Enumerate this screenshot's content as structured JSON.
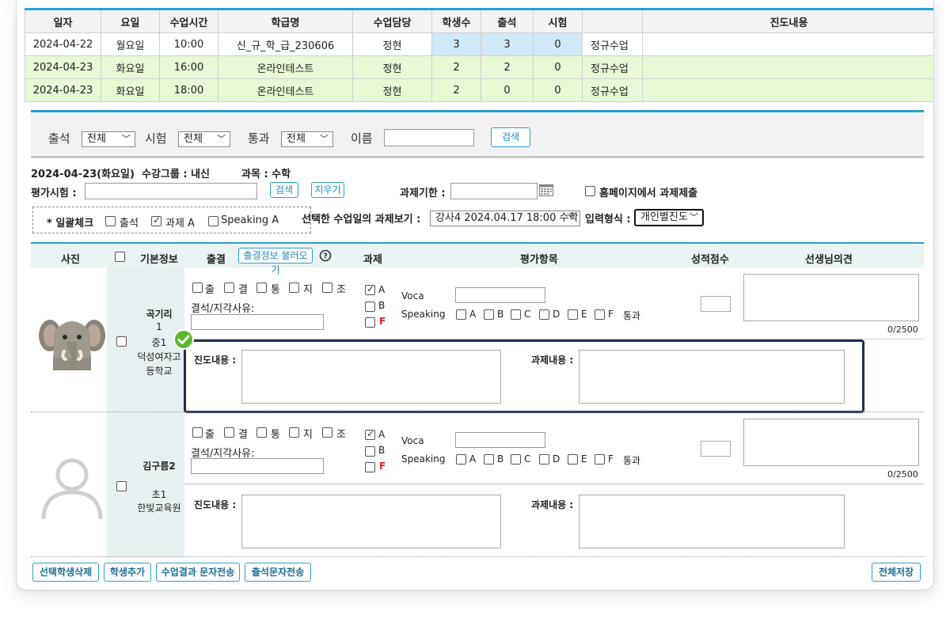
{
  "schedule": {
    "headers": [
      "일자",
      "요일",
      "수업시간",
      "학급명",
      "수업담당",
      "학생수",
      "출석",
      "시험",
      "",
      "진도내용"
    ],
    "rows": [
      [
        "2024-04-22",
        "월요일",
        "10:00",
        "신_규_학_급_230606",
        "정현",
        "3",
        "3",
        "0",
        "정규수업",
        ""
      ],
      [
        "2024-04-23",
        "화요일",
        "16:00",
        "온라인테스트",
        "정현",
        "2",
        "2",
        "0",
        "정규수업",
        ""
      ],
      [
        "2024-04-23",
        "화요일",
        "18:00",
        "온라인테스트",
        "정현",
        "2",
        "0",
        "0",
        "정규수업",
        ""
      ]
    ]
  },
  "filters": {
    "attendance_label": "출석",
    "attendance_value": "전체",
    "exam_label": "시험",
    "exam_value": "전체",
    "pass_label": "통과",
    "pass_value": "전체",
    "name_label": "이름",
    "name_value": "",
    "search_button": "검색"
  },
  "session": {
    "date": "2024-04-23(화요일)",
    "group": "수강그룹 : 내신",
    "subject": "과목 : 수학",
    "eval_label": "평가시험 :",
    "search_button": "검색",
    "clear_button": "지우기",
    "deadline_label": "과제기한 :",
    "homepage_submit": "홈페이지에서 과제제출",
    "bulk_label": "* 일괄체크",
    "bulk_attend": "출석",
    "bulk_homework": "과제 A",
    "bulk_speaking": "Speaking A",
    "view_homework_label": "선택한 수업일의 과제보기 :",
    "view_homework_value": "강사4 2024.04.17 18:00 수학",
    "input_type_label": "입력형식 :",
    "input_type_value": "개인별진도"
  },
  "student_header": {
    "photo": "사진",
    "basic": "기본정보",
    "attendance": "출결",
    "load_attendance": "출결정보 불러오기",
    "homework": "과제",
    "eval": "평가항목",
    "score": "성적점수",
    "comment": "선생님의견"
  },
  "row_labels": {
    "att_options": [
      "출",
      "결",
      "통",
      "지",
      "조"
    ],
    "absence_reason": "결석/지각사유:",
    "hw_options": [
      "A",
      "B",
      "F"
    ],
    "voca": "Voca",
    "speaking": "Speaking",
    "speaking_options": [
      "A",
      "B",
      "C",
      "D",
      "E",
      "F"
    ],
    "pass": "통과",
    "progress_label": "진도내용 :",
    "homework_label": "과제내용 :",
    "char_count": "0/2500"
  },
  "students": [
    {
      "name": "곡기리",
      "line1": "1",
      "line2": "중1",
      "line3": "덕성여자고",
      "line4": "등학교",
      "avatar": "elephant-avatar"
    },
    {
      "name": "김구름2",
      "line1": "",
      "line2": "초1",
      "line3": "한빛교육원",
      "line4": "",
      "avatar": "default-person-avatar"
    }
  ],
  "bottom_buttons": {
    "delete_selected": "선택학생삭제",
    "add_student": "학생추가",
    "send_result_sms": "수업결과 문자전송",
    "send_att_sms": "출석문자전송",
    "save_all": "전체저장"
  },
  "colors": {
    "accent": "#2a9fd6",
    "green_row": "#e6f8d4",
    "blue_cell": "#cfe9f8",
    "highlight": "#1f2f4f",
    "check_badge": "#5cb82f"
  }
}
